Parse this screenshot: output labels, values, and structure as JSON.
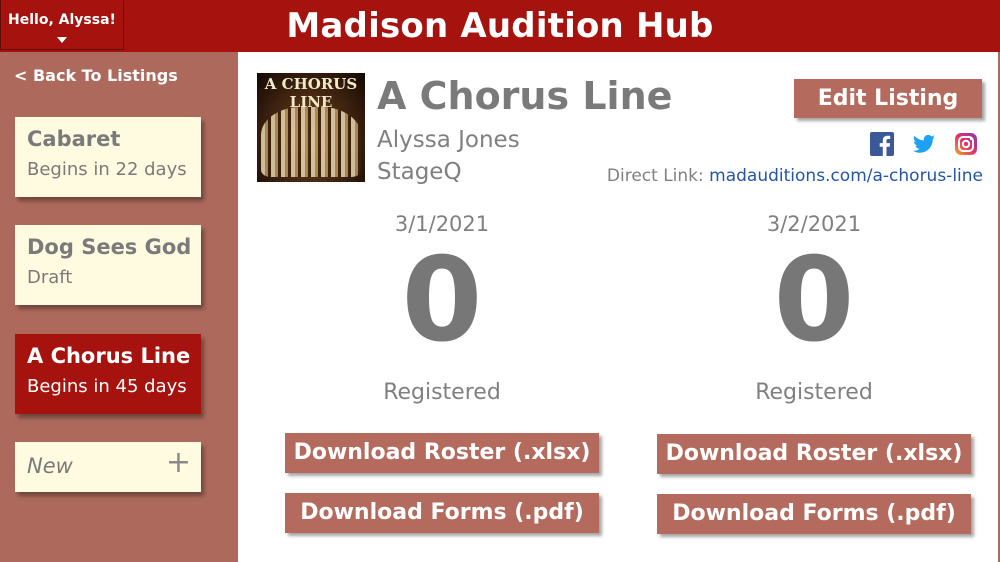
{
  "header": {
    "greeting": "Hello, Alyssa!",
    "app_title": "Madison Audition Hub"
  },
  "sidebar": {
    "back_label": "< Back To Listings",
    "listings": [
      {
        "title": "Cabaret",
        "subtitle": "Begins in 22 days",
        "active": false
      },
      {
        "title": "Dog Sees God",
        "subtitle": "Draft",
        "active": false
      },
      {
        "title": "A Chorus Line",
        "subtitle": "Begins in 45 days",
        "active": true
      }
    ],
    "new_label": "New",
    "new_icon": "plus-icon"
  },
  "listing": {
    "poster_text": "A CHORUS LINE",
    "title": "A Chorus Line",
    "producer": "Alyssa Jones",
    "theater": "StageQ",
    "edit_label": "Edit Listing",
    "social_icons": [
      "facebook-icon",
      "twitter-icon",
      "instagram-icon"
    ],
    "direct_link_label": "Direct Link:",
    "direct_link_url": "madauditions.com/a-chorus-line"
  },
  "days": [
    {
      "date": "3/1/2021",
      "count": "0",
      "count_label": "Registered",
      "roster_label": "Download Roster (.xlsx)",
      "forms_label": "Download Forms (.pdf)"
    },
    {
      "date": "3/2/2021",
      "count": "0",
      "count_label": "Registered",
      "roster_label": "Download Roster (.xlsx)",
      "forms_label": "Download Forms (.pdf)"
    }
  ],
  "colors": {
    "brand_red": "#a6120d",
    "sidebar_bg": "#ad6a5c",
    "button_bg": "#b46a5d",
    "card_bg": "#fffbe0",
    "link_blue": "#2255aa"
  }
}
